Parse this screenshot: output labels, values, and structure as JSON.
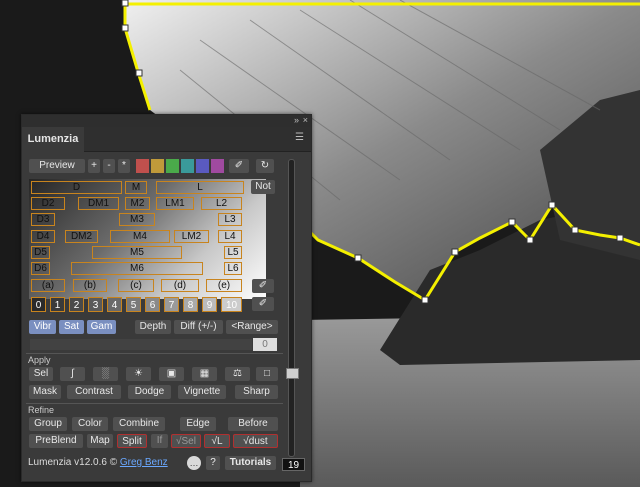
{
  "panel": {
    "tab_label": "Lumenzia",
    "collapse_icon": "double-chevron-icon",
    "menu_icon": "hamburger-menu-icon"
  },
  "toolbar": {
    "preview": "Preview",
    "plus": "+",
    "minus": "-",
    "star": "*",
    "swatch_colors": [
      "#c0504d",
      "#c09a3a",
      "#4aaa4a",
      "#3a9a9a",
      "#5a5ac0",
      "#a04aa0"
    ],
    "refresh_icon": "refresh-icon",
    "eyedropper_icon": "eyedropper-icon",
    "not": "Not"
  },
  "zones": {
    "row1": [
      "D",
      "M",
      "L"
    ],
    "row2": [
      "D2",
      "DM1",
      "M2",
      "LM1",
      "L2"
    ],
    "row3": [
      "D3",
      "M3",
      "L3"
    ],
    "row4": [
      "D4",
      "DM2",
      "M4",
      "LM2",
      "L4"
    ],
    "row5": [
      "D5",
      "M5",
      "L5"
    ],
    "row6": [
      "D6",
      "M6",
      "L6"
    ],
    "row7": [
      "(a)",
      "(b)",
      "(c)",
      "(d)",
      "(e)"
    ],
    "numbers": [
      "0",
      "1",
      "2",
      "3",
      "4",
      "5",
      "6",
      "7",
      "8",
      "9",
      "10"
    ]
  },
  "modes": {
    "vibr": "Vibr",
    "sat": "Sat",
    "gam": "Gam",
    "depth": "Depth",
    "diff": "Diff (+/-)",
    "range": "<Range>",
    "range_value": "0"
  },
  "apply": {
    "label": "Apply",
    "sel": "Sel",
    "icon_buttons": [
      "curves-icon",
      "levels-icon",
      "brightness-icon",
      "mask-exposure-icon",
      "film-icon",
      "balance-icon",
      "rectangle-icon"
    ],
    "row2": [
      "Mask",
      "Contrast",
      "Dodge",
      "Vignette",
      "Sharp"
    ]
  },
  "refine": {
    "label": "Refine",
    "row1": [
      "Group",
      "Color",
      "Combine",
      "Edge",
      "Before"
    ],
    "row2": [
      "PreBlend",
      "Map",
      "Split",
      "If",
      "√Sel",
      "√L",
      "√dust"
    ]
  },
  "slider": {
    "value": "19",
    "position": 0.72
  },
  "footer": {
    "version": "Lumenzia v12.0.6 © ",
    "author": "Greg Benz",
    "chat_icon": "chat-bubble-icon",
    "help": "?",
    "tutorials": "Tutorials"
  }
}
